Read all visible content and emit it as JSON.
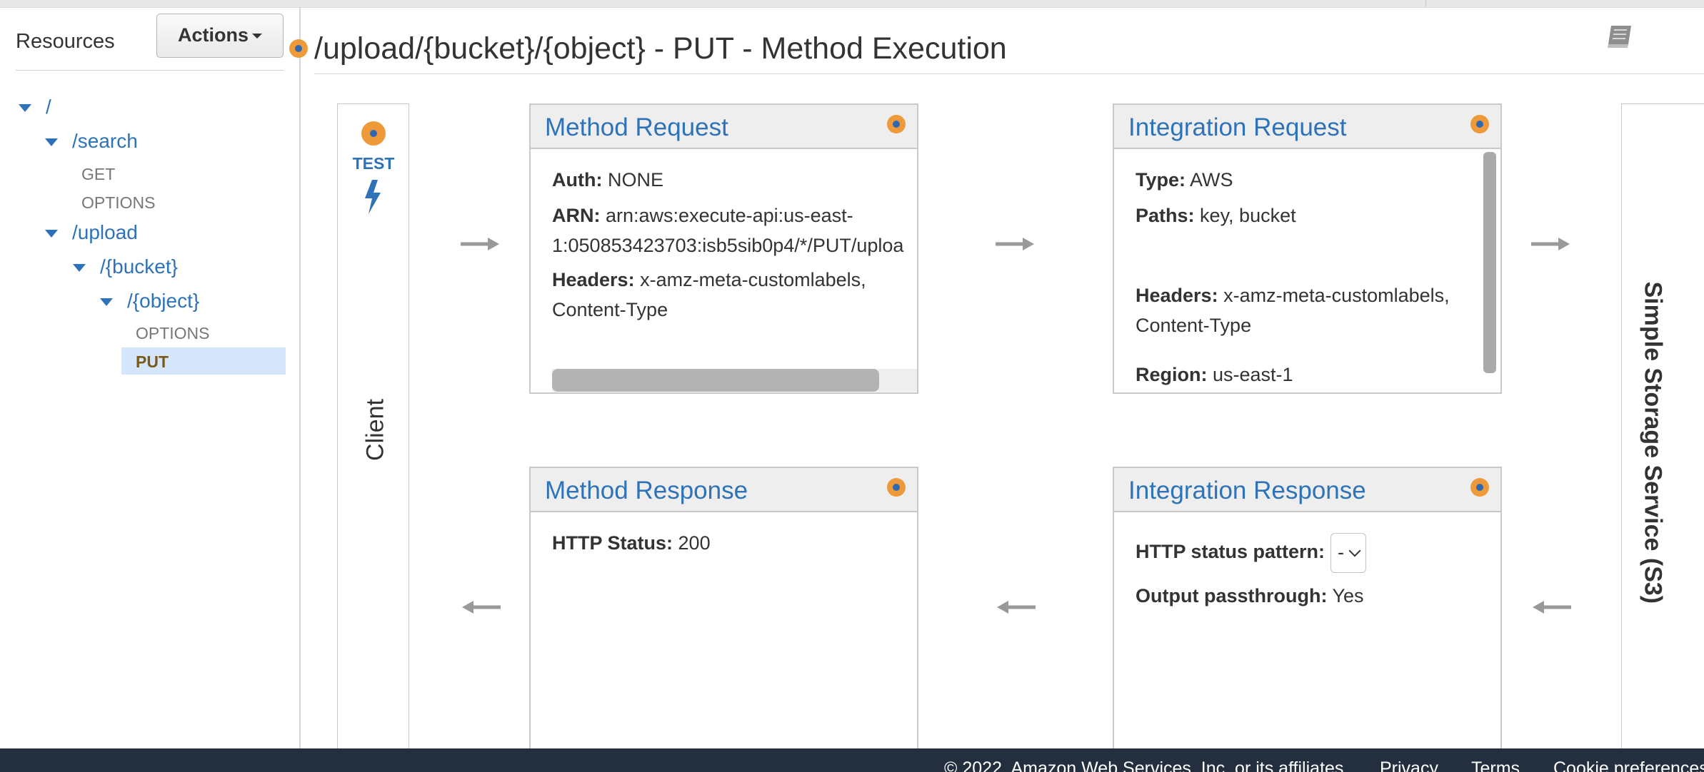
{
  "sidebar": {
    "title": "Resources",
    "actions_label": "Actions",
    "tree": [
      {
        "label": "/"
      },
      {
        "label": "/search"
      },
      {
        "label": "GET"
      },
      {
        "label": "OPTIONS"
      },
      {
        "label": "/upload"
      },
      {
        "label": "/{bucket}"
      },
      {
        "label": "/{object}"
      },
      {
        "label": "OPTIONS"
      },
      {
        "label": "PUT"
      }
    ]
  },
  "header": {
    "title": "/upload/{bucket}/{object} - PUT - Method Execution"
  },
  "client": {
    "test_label": "TEST",
    "label": "Client"
  },
  "backend": {
    "label": "Simple Storage Service (S3)"
  },
  "method_request": {
    "title": "Method Request",
    "auth_key": "Auth:",
    "auth_value": "NONE",
    "arn_key": "ARN:",
    "arn_value_line1": "arn:aws:execute-api:us-east-",
    "arn_value_line2": "1:050853423703:isb5sib0p4/*/PUT/uploa",
    "headers_key": "Headers:",
    "headers_value_line1": "x-amz-meta-customlabels,",
    "headers_value_line2": "Content-Type"
  },
  "integration_request": {
    "title": "Integration Request",
    "type_key": "Type:",
    "type_value": "AWS",
    "paths_key": "Paths:",
    "paths_value": "key, bucket",
    "headers_key": "Headers:",
    "headers_value_line1": "x-amz-meta-customlabels,",
    "headers_value_line2": "Content-Type",
    "region_key": "Region:",
    "region_value": "us-east-1"
  },
  "method_response": {
    "title": "Method Response",
    "status_key": "HTTP Status:",
    "status_value": "200"
  },
  "integration_response": {
    "title": "Integration Response",
    "pattern_key": "HTTP status pattern:",
    "pattern_value": "-",
    "passthrough_key": "Output passthrough:",
    "passthrough_value": "Yes"
  },
  "footer": {
    "copyright": "© 2022, Amazon Web Services, Inc. or its affiliates.",
    "privacy": "Privacy",
    "terms": "Terms",
    "cookies": "Cookie preferences"
  },
  "colors": {
    "link_blue": "#2e73b8",
    "badge_orange": "#ee9a3a",
    "selected_bg": "#d6e6fa",
    "footer_bg": "#232f3e"
  },
  "icons": [
    "book-icon",
    "lightning-bolt-icon",
    "right-arrow-icon",
    "left-arrow-icon",
    "expand-triangle-icon",
    "status-dot-icon"
  ]
}
